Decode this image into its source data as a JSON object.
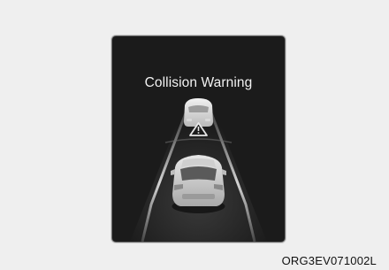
{
  "display": {
    "title": "Collision Warning",
    "warning_icon": "warning-triangle-icon",
    "lead_vehicle_icon": "lead-vehicle-icon",
    "own_vehicle_icon": "own-vehicle-icon"
  },
  "figure_code": "ORG3EV071002L",
  "colors": {
    "screen_background": "#1b1b1b",
    "title_text": "#f2f2f2",
    "lane_lines": "#d8d8d8"
  }
}
